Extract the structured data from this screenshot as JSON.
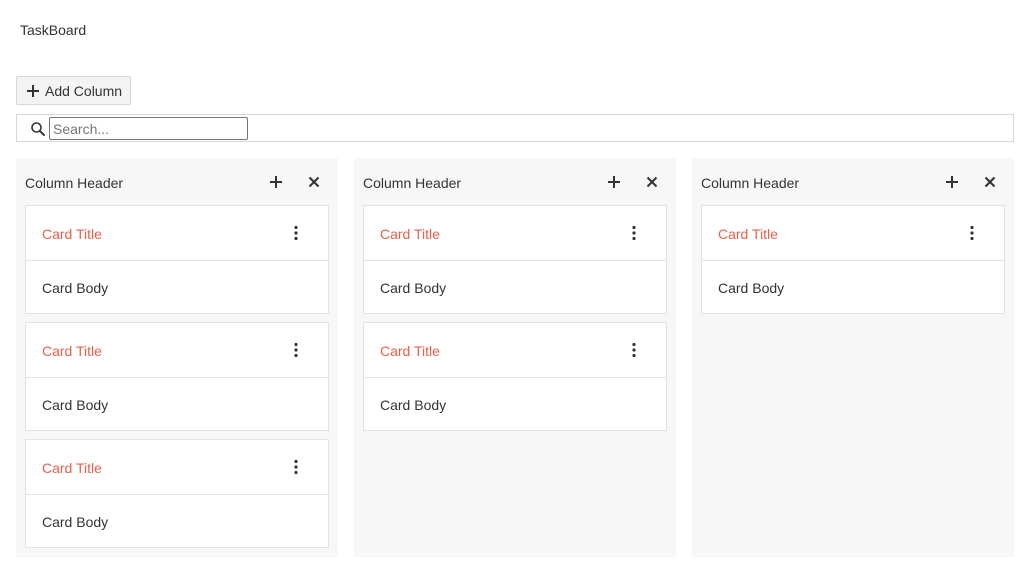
{
  "app": {
    "title": "TaskBoard"
  },
  "toolbar": {
    "add_column_label": "Add Column"
  },
  "search": {
    "placeholder": "Search...",
    "value": ""
  },
  "colors": {
    "card_title": "#e8604c",
    "column_bg": "#f7f7f7"
  },
  "columns": [
    {
      "header": "Column Header",
      "cards": [
        {
          "title": "Card Title",
          "body": "Card Body"
        },
        {
          "title": "Card Title",
          "body": "Card Body"
        },
        {
          "title": "Card Title",
          "body": "Card Body"
        }
      ]
    },
    {
      "header": "Column Header",
      "cards": [
        {
          "title": "Card Title",
          "body": "Card Body"
        },
        {
          "title": "Card Title",
          "body": "Card Body"
        }
      ]
    },
    {
      "header": "Column Header",
      "cards": [
        {
          "title": "Card Title",
          "body": "Card Body"
        }
      ]
    }
  ],
  "icons": {
    "add_column": "plus-icon",
    "search": "search-icon",
    "column_add": "plus-icon",
    "column_close": "close-icon",
    "card_menu": "more-vertical-icon"
  }
}
